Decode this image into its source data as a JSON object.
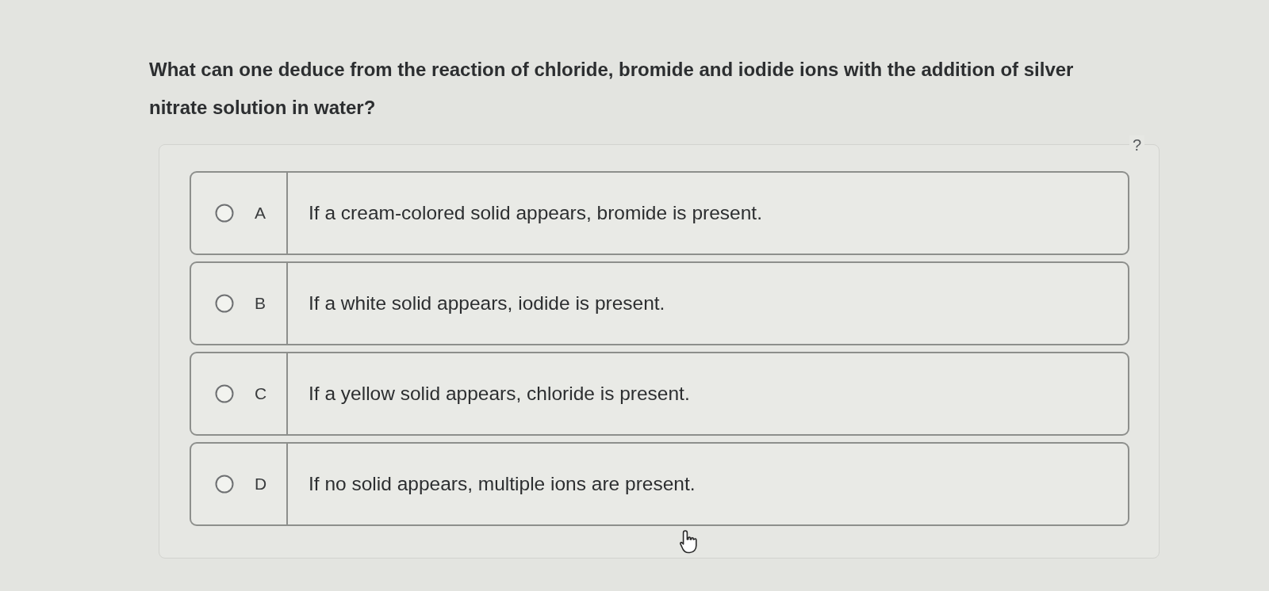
{
  "question": "What can one deduce from the reaction of chloride, bromide and iodide ions with the addition of silver nitrate solution in water?",
  "help": "?",
  "options": [
    {
      "letter": "A",
      "text": "If a cream-colored solid appears, bromide is present.",
      "selected": false
    },
    {
      "letter": "B",
      "text": "If a white solid appears, iodide is present.",
      "selected": false
    },
    {
      "letter": "C",
      "text": "If a yellow solid appears, chloride is present.",
      "selected": false
    },
    {
      "letter": "D",
      "text": "If no solid appears, multiple ions are present.",
      "selected": false
    }
  ]
}
